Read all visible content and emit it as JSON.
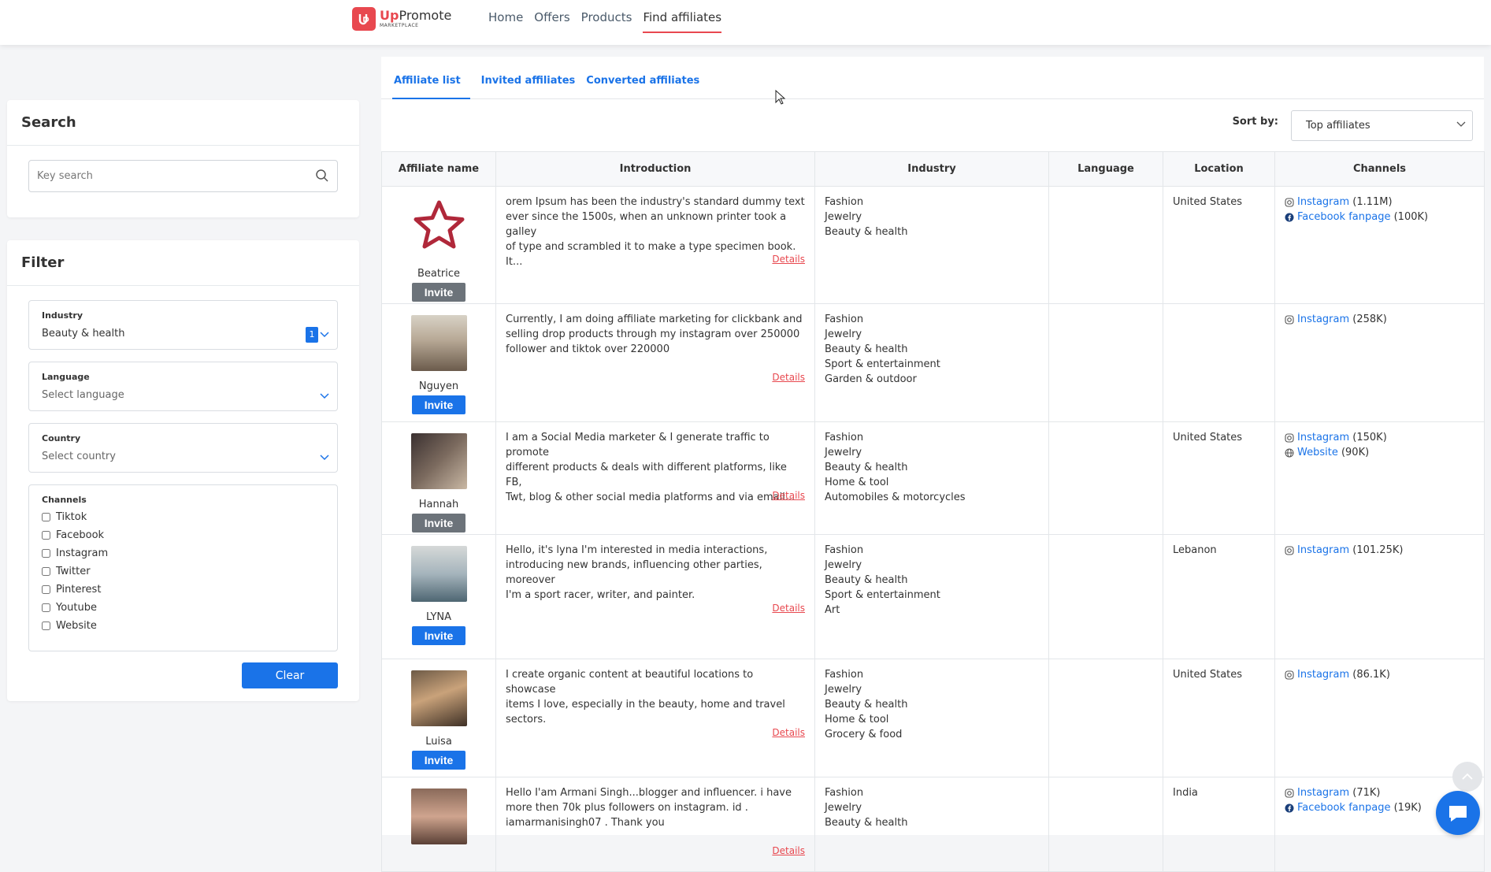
{
  "brand": {
    "mark": "Up",
    "name_up": "Up",
    "name_promote": "Promote",
    "sub": "MARKETPLACE"
  },
  "nav": [
    "Home",
    "Offers",
    "Products",
    "Find affiliates"
  ],
  "search": {
    "title": "Search",
    "placeholder": "Key search"
  },
  "filter": {
    "title": "Filter",
    "industry": {
      "label": "Industry",
      "value": "Beauty & health",
      "count": "1"
    },
    "language": {
      "label": "Language",
      "placeholder": "Select language"
    },
    "country": {
      "label": "Country",
      "placeholder": "Select country"
    },
    "channels": {
      "label": "Channels",
      "options": [
        "Tiktok",
        "Facebook",
        "Instagram",
        "Twitter",
        "Pinterest",
        "Youtube",
        "Website"
      ]
    },
    "clear_label": "Clear"
  },
  "tabs": [
    "Affiliate list",
    "Invited affiliates",
    "Converted affiliates"
  ],
  "sort": {
    "label": "Sort by:",
    "value": "Top affiliates"
  },
  "table": {
    "headers": [
      "Affiliate name",
      "Introduction",
      "Industry",
      "Language",
      "Location",
      "Channels"
    ],
    "details_label": "Details",
    "invite_label": "Invite",
    "rows": [
      {
        "name": "Beatrice",
        "intro": [
          "orem Ipsum has been the industry's standard dummy text",
          "ever since the 1500s, when an unknown printer took a galley",
          "of type and scrambled it to make a type specimen book. It..."
        ],
        "industries": [
          "Fashion",
          "Jewelry",
          "Beauty & health"
        ],
        "language": "",
        "location": "United States",
        "channels": [
          {
            "name": "Instagram",
            "count": "(1.11M)",
            "icon": "instagram-icon"
          },
          {
            "name": "Facebook fanpage",
            "count": "(100K)",
            "icon": "facebook-icon"
          }
        ]
      },
      {
        "name": "Nguyen",
        "intro": [
          "Currently, I am doing affiliate marketing for clickbank and",
          "selling drop products through my instagram over 250000",
          "follower and tiktok over 220000"
        ],
        "industries": [
          "Fashion",
          "Jewelry",
          "Beauty & health",
          "Sport & entertainment",
          "Garden & outdoor"
        ],
        "language": "",
        "location": "",
        "channels": [
          {
            "name": "Instagram",
            "count": "(258K)",
            "icon": "instagram-icon"
          }
        ]
      },
      {
        "name": "Hannah",
        "intro": [
          "I am a Social Media marketer & I generate traffic to promote",
          "different products & deals with different platforms, like FB,",
          "Twt, blog & other social media platforms and via email..."
        ],
        "industries": [
          "Fashion",
          "Jewelry",
          "Beauty & health",
          "Home & tool",
          "Automobiles & motorcycles"
        ],
        "language": "",
        "location": "United States",
        "channels": [
          {
            "name": "Instagram",
            "count": "(150K)",
            "icon": "instagram-icon"
          },
          {
            "name": "Website",
            "count": "(90K)",
            "icon": "globe-icon"
          }
        ]
      },
      {
        "name": "LYNA",
        "intro": [
          "Hello, it's lyna I'm interested in media interactions,",
          "introducing new brands, influencing other parties, moreover",
          "I'm a sport racer, writer, and painter."
        ],
        "industries": [
          "Fashion",
          "Jewelry",
          "Beauty & health",
          "Sport & entertainment",
          "Art"
        ],
        "language": "",
        "location": "Lebanon",
        "channels": [
          {
            "name": "Instagram",
            "count": "(101.25K)",
            "icon": "instagram-icon"
          }
        ]
      },
      {
        "name": "Luisa",
        "intro": [
          "I create organic content at beautiful locations to showcase",
          "items I love, especially in the beauty, home and travel",
          "sectors."
        ],
        "industries": [
          "Fashion",
          "Jewelry",
          "Beauty & health",
          "Home & tool",
          "Grocery & food"
        ],
        "language": "",
        "location": "United States",
        "channels": [
          {
            "name": "Instagram",
            "count": "(86.1K)",
            "icon": "instagram-icon"
          }
        ]
      },
      {
        "name": "",
        "intro": [
          "Hello  I'am Armani Singh...blogger and influencer. i have",
          "more then 70k plus followers on instagram. id .",
          "iamarmanisingh07  . Thank you"
        ],
        "industries": [
          "Fashion",
          "Jewelry",
          "Beauty & health"
        ],
        "language": "",
        "location": "India",
        "channels": [
          {
            "name": "Instagram",
            "count": "(71K)",
            "icon": "instagram-icon"
          },
          {
            "name": "Facebook fanpage",
            "count": "(19K)",
            "icon": "facebook-icon"
          }
        ]
      }
    ]
  }
}
